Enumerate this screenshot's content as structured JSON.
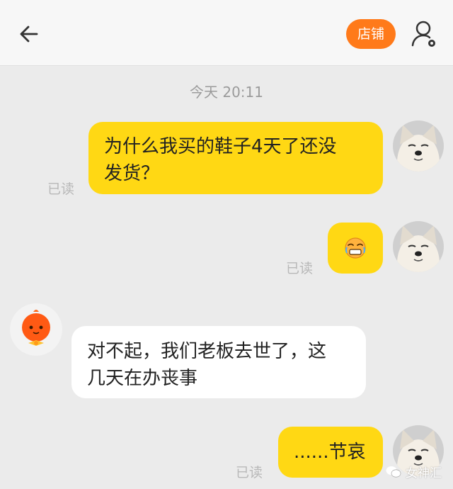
{
  "header": {
    "shop_label": "店铺"
  },
  "chat": {
    "timestamp": "今天  20:11",
    "messages": [
      {
        "side": "me",
        "text": "为什么我买的鞋子4天了还没发货？",
        "status": "已读"
      },
      {
        "side": "me",
        "sticker": "crying-emoji",
        "status": "已读"
      },
      {
        "side": "them",
        "text": "对不起，我们老板去世了，这几天在办丧事"
      },
      {
        "side": "me",
        "text": "......节哀",
        "status": "已读"
      }
    ]
  },
  "message_lines": {
    "m1_line1": "为什么我买的鞋子4天了还没",
    "m1_line2": "发货？",
    "m3_line1": "对不起，我们老板去世了，这",
    "m3_line2": "几天在办丧事",
    "m4": "......节哀"
  },
  "watermark": {
    "text": "女神汇"
  },
  "colors": {
    "header_bg": "#f7f7f7",
    "chat_bg": "#ebebeb",
    "my_bubble": "#ffd814",
    "their_bubble": "#ffffff",
    "shop_button": "#ff7a1a",
    "read_text": "#b8b8b8"
  }
}
